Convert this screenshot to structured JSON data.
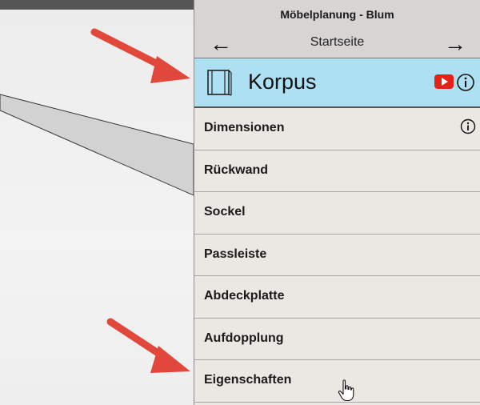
{
  "panel": {
    "app_title": "Möbelplanung - Blum",
    "nav_label": "Startseite",
    "back_icon": "arrow-left-icon",
    "forward_icon": "arrow-right-icon"
  },
  "korpus": {
    "title": "Korpus",
    "icon": "cabinet-icon",
    "youtube_icon": "youtube-icon",
    "info_icon": "info-icon",
    "background": "#aee0f4"
  },
  "menu": {
    "items": [
      {
        "label": "Dimensionen",
        "has_info": true
      },
      {
        "label": "Rückwand"
      },
      {
        "label": "Sockel"
      },
      {
        "label": "Passleiste"
      },
      {
        "label": "Abdeckplatte"
      },
      {
        "label": "Aufdopplung"
      },
      {
        "label": "Eigenschaften"
      }
    ]
  },
  "colors": {
    "arrow_annotation": "#e2473c",
    "header_bg": "#d7d5d4",
    "menu_bg": "#ebe7e3"
  }
}
